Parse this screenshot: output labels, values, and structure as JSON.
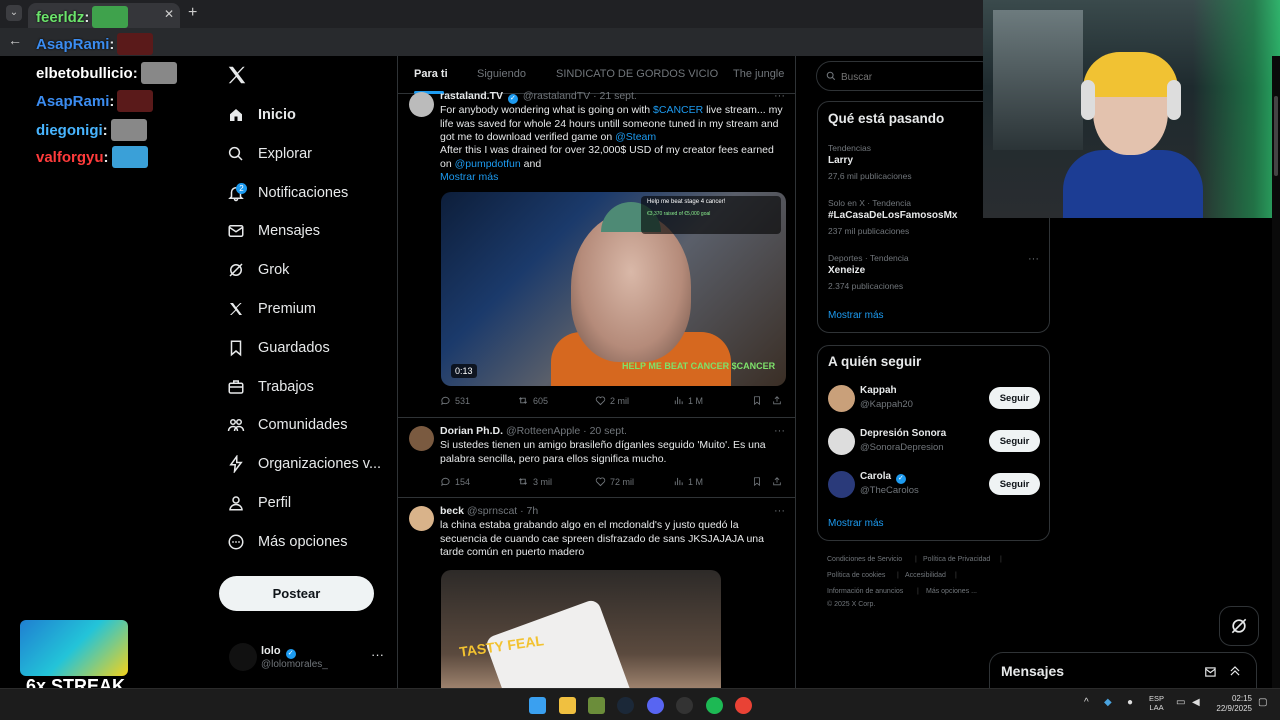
{
  "chat": [
    {
      "user": "feerldz",
      "color": "#6be36b",
      "emote": "#3fa24c"
    },
    {
      "user": "AsapRami",
      "color": "#3b8cf0",
      "emote": "#5a1a1a"
    },
    {
      "user": "elbetobullicio",
      "color": "#ffffff",
      "emote": "#888888"
    },
    {
      "user": "AsapRami",
      "color": "#3b8cf0",
      "emote": "#5a1a1a"
    },
    {
      "user": "diegonigi",
      "color": "#48b5ff",
      "emote": "#888888"
    },
    {
      "user": "valforgyu",
      "color": "#ff3b3b",
      "emote": "#3aa0d8"
    }
  ],
  "chat_sep": ":",
  "nav": {
    "items": [
      {
        "label": "Inicio",
        "icon": "home-icon",
        "active": true
      },
      {
        "label": "Explorar",
        "icon": "search-icon"
      },
      {
        "label": "Notificaciones",
        "icon": "bell-icon"
      },
      {
        "label": "Mensajes",
        "icon": "mail-icon"
      },
      {
        "label": "Grok",
        "icon": "grok-icon"
      },
      {
        "label": "Premium",
        "icon": "x-logo-icon"
      },
      {
        "label": "Guardados",
        "icon": "bookmark-icon"
      },
      {
        "label": "Trabajos",
        "icon": "briefcase-icon"
      },
      {
        "label": "Comunidades",
        "icon": "people-icon"
      },
      {
        "label": "Organizaciones v...",
        "icon": "lightning-icon"
      },
      {
        "label": "Perfil",
        "icon": "person-icon"
      },
      {
        "label": "Más opciones",
        "icon": "more-circle-icon"
      }
    ],
    "notif_count": "2",
    "post_label": "Postear"
  },
  "profile": {
    "name": "lolo",
    "handle": "@lolomorales_",
    "more": "···"
  },
  "tabs": [
    "Para ti",
    "Siguiendo",
    "SINDICATO DE GORDOS VICIO",
    "The jungle"
  ],
  "tweets": [
    {
      "name": "rastaland.TV",
      "handle": "@rastalandTV",
      "date": "· 21 sept.",
      "text_parts": [
        "For anybody wondering what is going on with ",
        "$CANCER",
        " live stream... my life was saved for whole 24 hours untill someone tuned in my stream and got me to download verified game on ",
        "@Steam"
      ],
      "text2_parts": [
        "After this I was drained for over 32,000$ USD of my creator fees earned on ",
        "@pumpdotfun",
        " and"
      ],
      "show_more": "Mostrar más",
      "video": {
        "time": "0:13",
        "caption": "HELP ME BEAT CANCER $CANCER",
        "panel_title": "Help me beat stage 4 cancer!",
        "panel_text": "€3,370 raised of €5,000 goal"
      },
      "replies": "531",
      "reposts": "605",
      "likes": "2 mil",
      "views": "1 M"
    },
    {
      "name": "Dorian Ph.D.",
      "handle": "@RotteenApple",
      "date": "· 20 sept.",
      "text": "Si ustedes tienen un amigo brasileño díganles seguido 'Muito'. Es una palabra sencilla, pero para ellos significa mucho.",
      "replies": "154",
      "reposts": "3 mil",
      "likes": "72 mil",
      "views": "1 M"
    },
    {
      "name": "beck",
      "handle": "@sprnscat",
      "date": "· 7h",
      "text": "la china estaba grabando algo en el mcdonald's y justo quedó la secuencia de cuando cae spreen disfrazado de sans JKSJAJAJA una tarde común en puerto madero",
      "image_text": "TASTY FEAL"
    }
  ],
  "search": {
    "placeholder": "Buscar"
  },
  "trends": {
    "title": "Qué está pasando",
    "items": [
      {
        "meta": "Tendencias",
        "name": "Larry",
        "count": "27,6 mil publicaciones"
      },
      {
        "meta": "Solo en X · Tendencia",
        "name": "#LaCasaDeLosFamososMx",
        "count": "237 mil publicaciones"
      },
      {
        "meta": "Deportes · Tendencia",
        "name": "Xeneize",
        "count": "2.374 publicaciones"
      }
    ],
    "show_more": "Mostrar más"
  },
  "follow": {
    "title": "A quién seguir",
    "items": [
      {
        "name": "Kappah",
        "handle": "@Kappah20",
        "color": "#c9a07a"
      },
      {
        "name": "Depresión Sonora",
        "handle": "@SonoraDepresion",
        "color": "#dddddd"
      },
      {
        "name": "Carola",
        "handle": "@TheCarolos",
        "color": "#2a3a7a",
        "verified": true
      }
    ],
    "btn": "Seguir",
    "show_more": "Mostrar más"
  },
  "footer": [
    "Condiciones de Servicio",
    "Política de Privacidad",
    "Política de cookies",
    "Accesibilidad",
    "Información de anuncios",
    "Más opciones ...",
    "© 2025 X Corp."
  ],
  "streak": "6x STREAK",
  "messages_dock": {
    "title": "Mensajes"
  },
  "taskbar": {
    "lang1": "ESP",
    "lang2": "LAA",
    "time": "02:15",
    "date": "22/9/2025"
  },
  "colors": {
    "accent": "#1d9bf0",
    "bg": "#000000",
    "border": "#2f3336",
    "muted": "#71767b"
  }
}
